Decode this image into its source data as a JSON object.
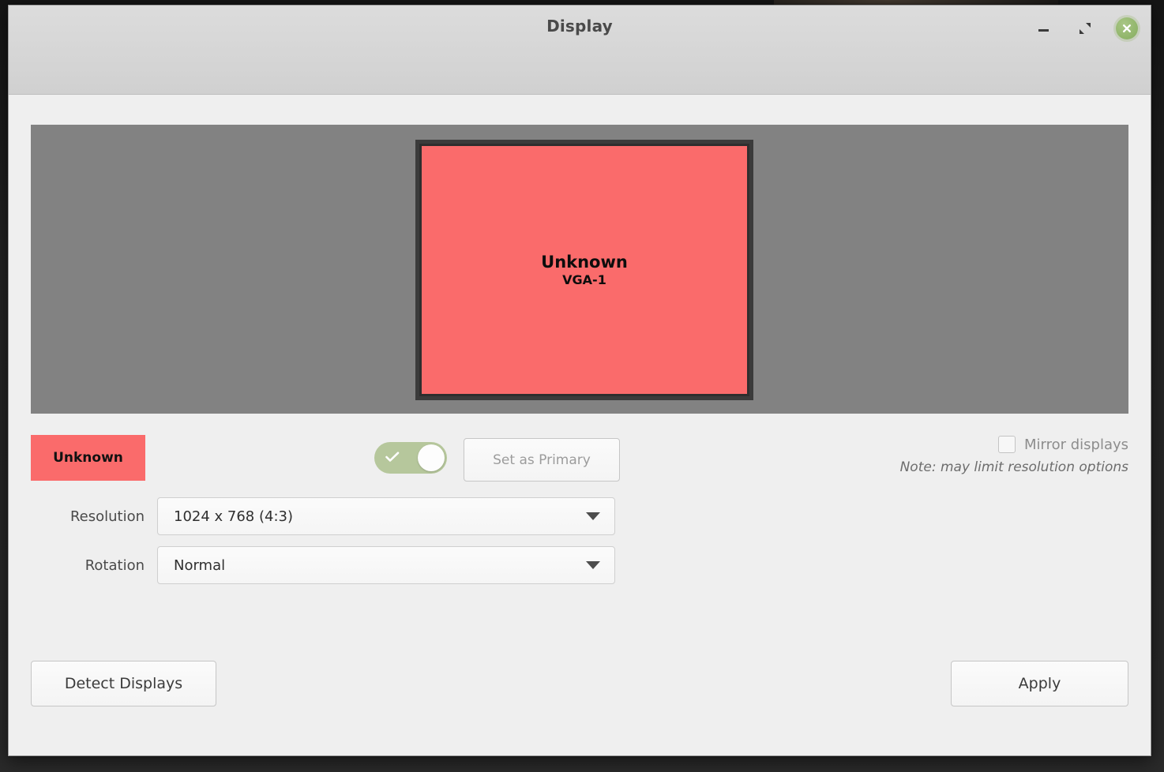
{
  "window": {
    "title": "Display",
    "controls": {
      "minimize": "minimize",
      "maximize": "restore",
      "close": "close"
    }
  },
  "preview": {
    "monitor": {
      "name": "Unknown",
      "output": "VGA-1",
      "color": "#fa6b6b"
    },
    "canvas_color": "#828282"
  },
  "controls": {
    "monitor_badge": "Unknown",
    "primary_toggle": {
      "state": "on",
      "color": "#b6c79c"
    },
    "set_primary_label": "Set as Primary",
    "mirror": {
      "label": "Mirror displays",
      "checked": "false",
      "note": "Note: may limit resolution options"
    }
  },
  "form": {
    "resolution": {
      "label": "Resolution",
      "value": "1024 x 768 (4:3)"
    },
    "rotation": {
      "label": "Rotation",
      "value": "Normal"
    }
  },
  "footer": {
    "detect_label": "Detect Displays",
    "apply_label": "Apply"
  }
}
